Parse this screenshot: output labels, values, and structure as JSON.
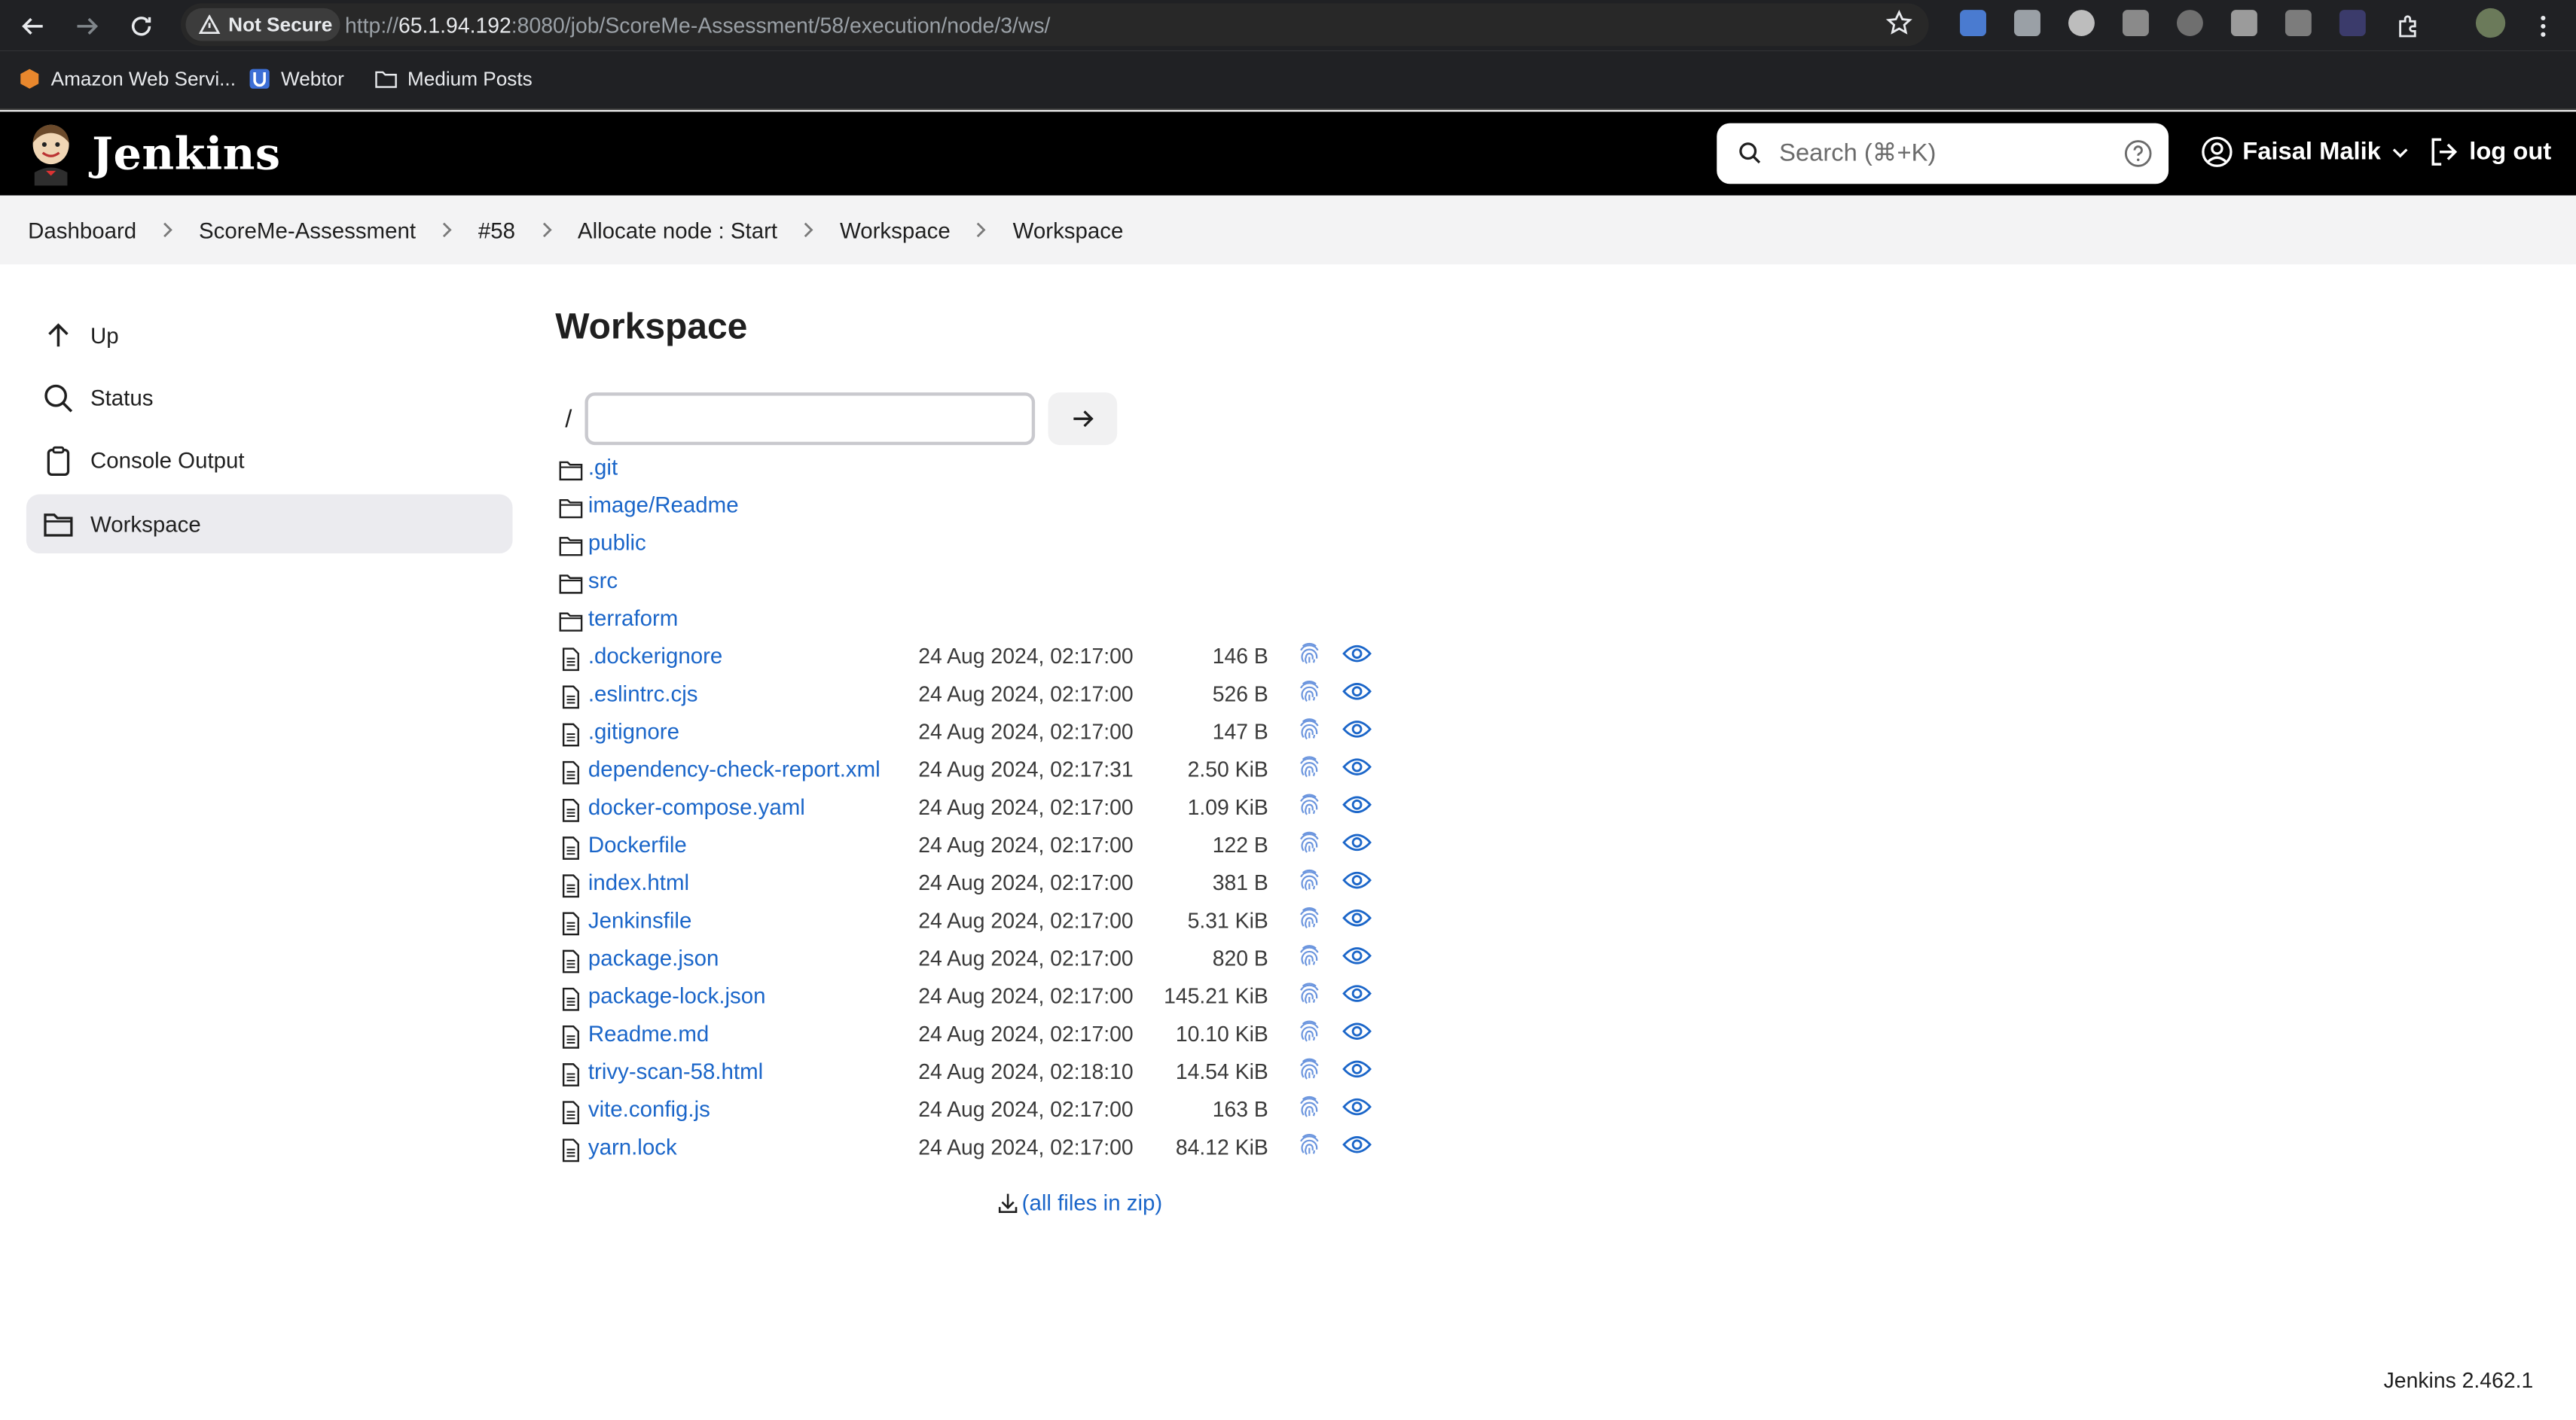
{
  "browser": {
    "security_label": "Not Secure",
    "url_prefix": "http://",
    "url_host": "65.1.94.192",
    "url_path": ":8080/job/ScoreMe-Assessment/58/execution/node/3/ws/",
    "bookmarks": [
      "Amazon Web Servi...",
      "Webtor",
      "Medium Posts"
    ]
  },
  "header": {
    "app_name": "Jenkins",
    "search_placeholder": "Search (⌘+K)",
    "user_name": "Faisal Malik",
    "logout_label": "log out"
  },
  "breadcrumb": [
    "Dashboard",
    "ScoreMe-Assessment",
    "#58",
    "Allocate node : Start",
    "Workspace",
    "Workspace"
  ],
  "sidebar": {
    "items": [
      {
        "label": "Up",
        "icon": "arrow-up-icon"
      },
      {
        "label": "Status",
        "icon": "search-icon"
      },
      {
        "label": "Console Output",
        "icon": "clipboard-icon"
      },
      {
        "label": "Workspace",
        "icon": "folder-icon",
        "active": true
      }
    ]
  },
  "main": {
    "title": "Workspace",
    "path_prefix": "/",
    "path_value": "",
    "folders": [
      {
        "name": ".git"
      },
      {
        "name": "image",
        "sub": "Readme"
      },
      {
        "name": "public"
      },
      {
        "name": "src"
      },
      {
        "name": "terraform"
      }
    ],
    "files": [
      {
        "name": ".dockerignore",
        "date": "24 Aug 2024, 02:17:00",
        "size": "146 B"
      },
      {
        "name": ".eslintrc.cjs",
        "date": "24 Aug 2024, 02:17:00",
        "size": "526 B"
      },
      {
        "name": ".gitignore",
        "date": "24 Aug 2024, 02:17:00",
        "size": "147 B"
      },
      {
        "name": "dependency-check-report.xml",
        "date": "24 Aug 2024, 02:17:31",
        "size": "2.50 KiB"
      },
      {
        "name": "docker-compose.yaml",
        "date": "24 Aug 2024, 02:17:00",
        "size": "1.09 KiB"
      },
      {
        "name": "Dockerfile",
        "date": "24 Aug 2024, 02:17:00",
        "size": "122 B"
      },
      {
        "name": "index.html",
        "date": "24 Aug 2024, 02:17:00",
        "size": "381 B"
      },
      {
        "name": "Jenkinsfile",
        "date": "24 Aug 2024, 02:17:00",
        "size": "5.31 KiB"
      },
      {
        "name": "package.json",
        "date": "24 Aug 2024, 02:17:00",
        "size": "820 B"
      },
      {
        "name": "package-lock.json",
        "date": "24 Aug 2024, 02:17:00",
        "size": "145.21 KiB"
      },
      {
        "name": "Readme.md",
        "date": "24 Aug 2024, 02:17:00",
        "size": "10.10 KiB"
      },
      {
        "name": "trivy-scan-58.html",
        "date": "24 Aug 2024, 02:18:10",
        "size": "14.54 KiB"
      },
      {
        "name": "vite.config.js",
        "date": "24 Aug 2024, 02:17:00",
        "size": "163 B"
      },
      {
        "name": "yarn.lock",
        "date": "24 Aug 2024, 02:17:00",
        "size": "84.12 KiB"
      }
    ],
    "zip_label": "(all files in zip)"
  },
  "footer": {
    "version": "Jenkins 2.462.1"
  },
  "colors": {
    "link": "#1b66c9",
    "header_bg": "#000000",
    "breadcrumb_bg": "#f3f3f4",
    "active_item_bg": "#ebebef"
  }
}
